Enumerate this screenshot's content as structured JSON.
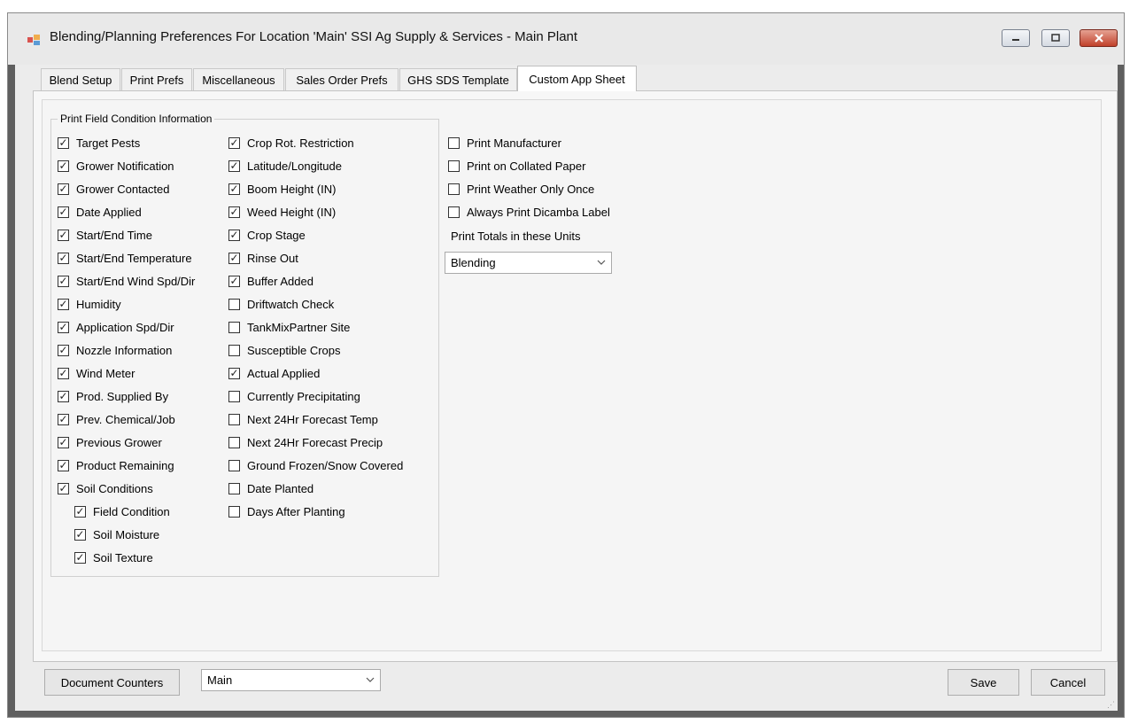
{
  "window": {
    "title": "Blending/Planning Preferences For Location 'Main' SSI Ag Supply & Services - Main Plant",
    "icon": "app-icon"
  },
  "tabs": [
    {
      "label": "Blend Setup",
      "active": false
    },
    {
      "label": "Print Prefs",
      "active": false
    },
    {
      "label": "Miscellaneous",
      "active": false
    },
    {
      "label": "Sales Order Prefs",
      "active": false
    },
    {
      "label": "GHS SDS Template",
      "active": false
    },
    {
      "label": "Custom App Sheet",
      "active": true
    }
  ],
  "group": {
    "title": "Print Field Condition Information",
    "col1": [
      {
        "label": "Target Pests",
        "checked": true
      },
      {
        "label": "Grower Notification",
        "checked": true
      },
      {
        "label": "Grower Contacted",
        "checked": true
      },
      {
        "label": "Date Applied",
        "checked": true
      },
      {
        "label": "Start/End Time",
        "checked": true
      },
      {
        "label": "Start/End Temperature",
        "checked": true
      },
      {
        "label": "Start/End Wind Spd/Dir",
        "checked": true
      },
      {
        "label": "Humidity",
        "checked": true
      },
      {
        "label": "Application Spd/Dir",
        "checked": true
      },
      {
        "label": "Nozzle Information",
        "checked": true
      },
      {
        "label": "Wind Meter",
        "checked": true
      },
      {
        "label": "Prod. Supplied By",
        "checked": true
      },
      {
        "label": "Prev. Chemical/Job",
        "checked": true
      },
      {
        "label": "Previous Grower",
        "checked": true
      },
      {
        "label": "Product Remaining",
        "checked": true
      },
      {
        "label": "Soil Conditions",
        "checked": true
      }
    ],
    "soil_sub": [
      {
        "label": "Field Condition",
        "checked": true
      },
      {
        "label": "Soil Moisture",
        "checked": true
      },
      {
        "label": "Soil Texture",
        "checked": true
      }
    ],
    "col2": [
      {
        "label": "Crop Rot. Restriction",
        "checked": true
      },
      {
        "label": "Latitude/Longitude",
        "checked": true
      },
      {
        "label": "Boom Height (IN)",
        "checked": true
      },
      {
        "label": "Weed Height (IN)",
        "checked": true
      },
      {
        "label": "Crop Stage",
        "checked": true
      },
      {
        "label": "Rinse Out",
        "checked": true
      },
      {
        "label": "Buffer Added",
        "checked": true
      },
      {
        "label": "Driftwatch Check",
        "checked": false
      },
      {
        "label": "TankMixPartner Site",
        "checked": false
      },
      {
        "label": "Susceptible Crops",
        "checked": false
      },
      {
        "label": "Actual Applied",
        "checked": true
      },
      {
        "label": "Currently Precipitating",
        "checked": false
      },
      {
        "label": "Next 24Hr Forecast Temp",
        "checked": false
      },
      {
        "label": "Next 24Hr Forecast Precip",
        "checked": false
      },
      {
        "label": "Ground Frozen/Snow Covered",
        "checked": false
      },
      {
        "label": "Date Planted",
        "checked": false
      },
      {
        "label": "Days After Planting",
        "checked": false
      }
    ]
  },
  "right_options": [
    {
      "label": "Print Manufacturer",
      "checked": false
    },
    {
      "label": "Print on Collated Paper",
      "checked": false
    },
    {
      "label": "Print Weather Only Once",
      "checked": false
    },
    {
      "label": "Always Print Dicamba Label",
      "checked": false
    }
  ],
  "units": {
    "label": "Print Totals in these Units",
    "value": "Blending"
  },
  "footer": {
    "doc_counters_label": "Document Counters",
    "location_value": "Main",
    "save_label": "Save",
    "cancel_label": "Cancel"
  },
  "check_glyph": "✓",
  "colors": {
    "title_bar": "#e9e9e9",
    "client_bg": "#ececec",
    "close_button": "#c0402a"
  }
}
